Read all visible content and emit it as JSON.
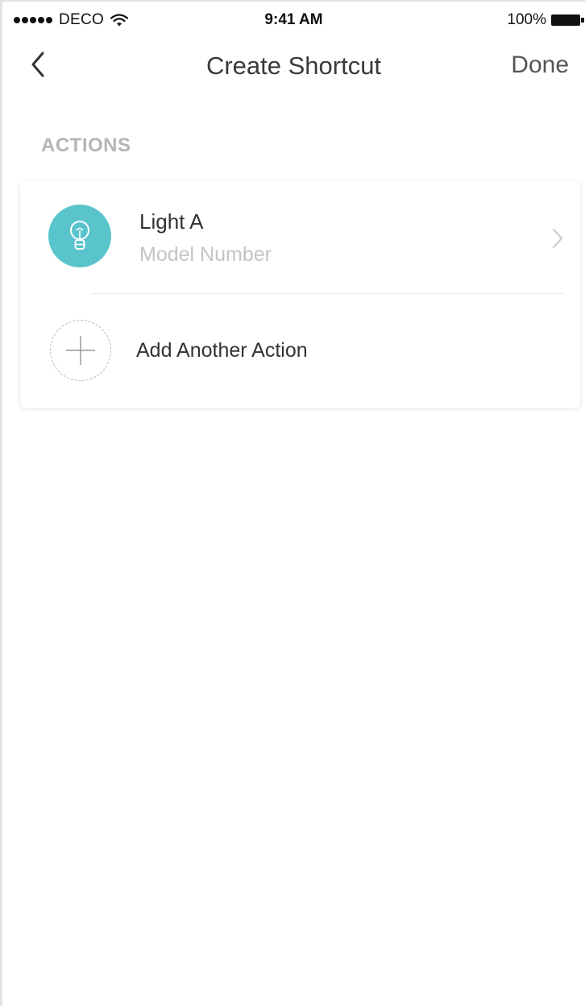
{
  "status_bar": {
    "carrier": "DECO",
    "time": "9:41 AM",
    "battery": "100%"
  },
  "nav": {
    "title": "Create Shortcut",
    "done_label": "Done",
    "back_icon": "chevron-left-icon"
  },
  "section": {
    "label": "ACTIONS"
  },
  "actions": {
    "device": {
      "name": "Light A",
      "model": "Model Number",
      "icon": "light-bulb-icon",
      "accent_color": "#5ac4cc"
    },
    "add": {
      "label": "Add Another Action",
      "icon": "plus-icon"
    }
  }
}
